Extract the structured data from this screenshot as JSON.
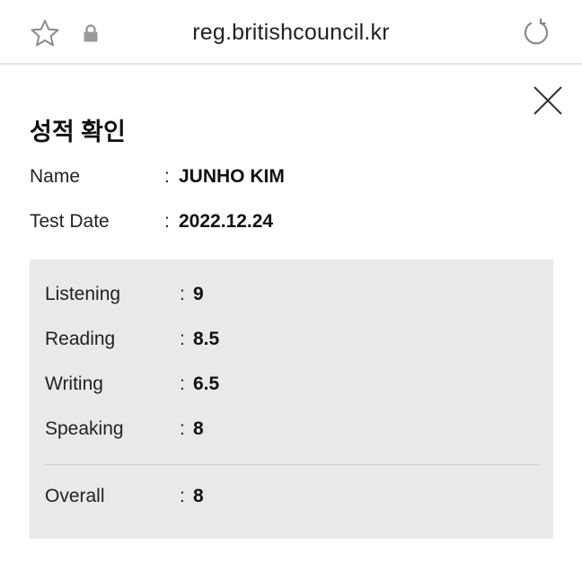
{
  "browser": {
    "url": "reg.britishcouncil.kr",
    "icons": [
      "star-icon",
      "lock-icon",
      "reload-icon"
    ]
  },
  "dialog": {
    "title": "성적 확인",
    "close_icon": "close-icon",
    "candidate": {
      "name_label": "Name",
      "name_value": "JUNHO KIM",
      "date_label": "Test Date",
      "date_value": "2022.12.24",
      "separator": ":"
    },
    "scores": [
      {
        "label": "Listening",
        "value": "9"
      },
      {
        "label": "Reading",
        "value": "8.5"
      },
      {
        "label": "Writing",
        "value": "6.5"
      },
      {
        "label": "Speaking",
        "value": "8"
      }
    ],
    "overall": {
      "label": "Overall",
      "value": "8"
    }
  },
  "colors": {
    "score_box_bg": "#e9e9e9",
    "text": "#111111",
    "divider": "#cfcfcf"
  }
}
